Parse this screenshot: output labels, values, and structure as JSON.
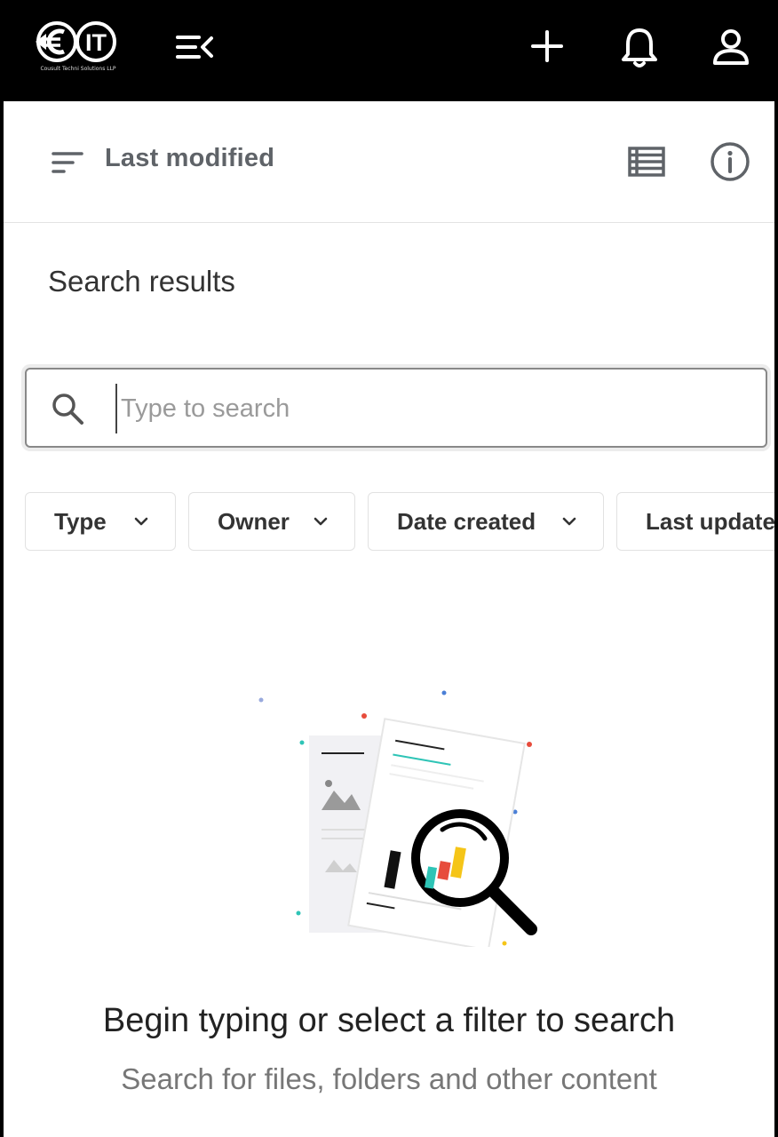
{
  "header": {
    "logo_text": "€IT",
    "logo_tagline": "Cousult Techni Solutions LLP",
    "icons": [
      "menu-collapse-icon",
      "add-icon",
      "bell-icon",
      "user-icon"
    ]
  },
  "toolbar": {
    "sort_label": "Last modified",
    "icons": [
      "sort-icon",
      "list-view-icon",
      "info-icon"
    ]
  },
  "main": {
    "title": "Search results",
    "search": {
      "placeholder": "Type to search",
      "value": ""
    },
    "filters": [
      {
        "label": "Type"
      },
      {
        "label": "Owner"
      },
      {
        "label": "Date created"
      },
      {
        "label": "Last updated"
      }
    ],
    "empty_state": {
      "title": "Begin typing or select a filter to search",
      "subtitle": "Search for files, folders and other content"
    }
  },
  "colors": {
    "header_bg": "#000000",
    "content_bg": "#ffffff",
    "text_primary": "#222222",
    "text_secondary": "#777777",
    "accent_yellow": "#f5c518",
    "accent_red": "#e74c3c",
    "accent_teal": "#2ec4b6"
  }
}
